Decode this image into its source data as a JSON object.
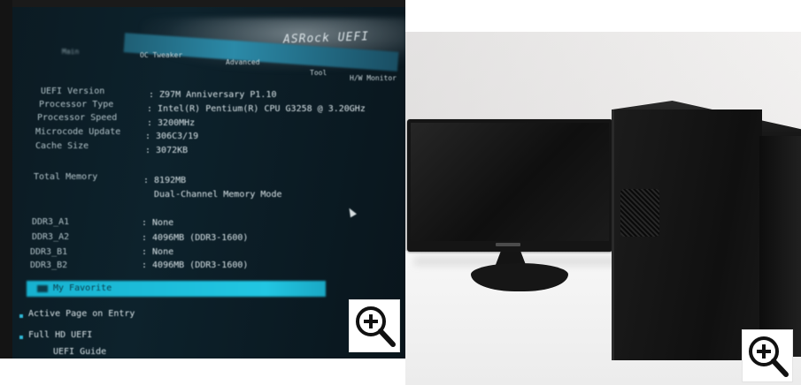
{
  "left_photo": {
    "brand": "ASRock UEFI",
    "tabs": [
      "Main",
      "OC Tweaker",
      "Advanced",
      "Tool",
      "H/W Monitor"
    ],
    "system_info": [
      {
        "label": "UEFI Version",
        "value": ": Z97M Anniversary P1.10"
      },
      {
        "label": "Processor Type",
        "value": ": Intel(R) Pentium(R) CPU G3258 @ 3.20GHz"
      },
      {
        "label": "Processor Speed",
        "value": ": 3200MHz"
      },
      {
        "label": "Microcode Update",
        "value": ": 306C3/19"
      },
      {
        "label": "Cache Size",
        "value": ": 3072KB"
      }
    ],
    "memory": {
      "label": "Total Memory",
      "value": ": 8192MB",
      "mode": "Dual-Channel Memory Mode"
    },
    "dimms": [
      {
        "label": "DDR3_A1",
        "value": ": None"
      },
      {
        "label": "DDR3_A2",
        "value": ": 4096MB (DDR3-1600)"
      },
      {
        "label": "DDR3_B1",
        "value": ": None"
      },
      {
        "label": "DDR3_B2",
        "value": ": 4096MB (DDR3-1600)"
      }
    ],
    "favorite": "My Favorite",
    "options": [
      "Active Page on Entry",
      "Full HD UEFI",
      "UEFI Guide"
    ]
  },
  "zoom_icon": "magnifier-plus-icon"
}
